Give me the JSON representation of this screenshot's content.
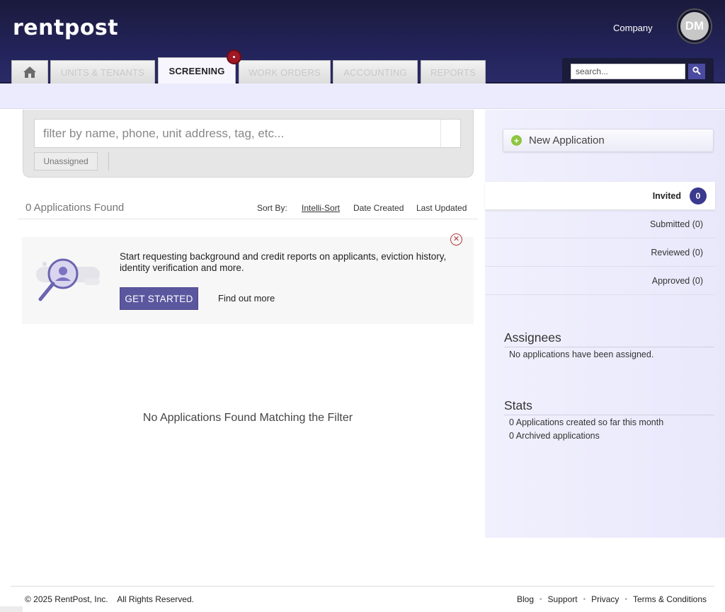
{
  "header": {
    "logo": "rentpost",
    "company_label": "Company",
    "avatar_initials": "DM",
    "tabs": [
      {
        "label": ""
      },
      {
        "label": "UNITS & TENANTS"
      },
      {
        "label": "SCREENING"
      },
      {
        "label": "WORK ORDERS"
      },
      {
        "label": "ACCOUNTING"
      },
      {
        "label": "REPORTS"
      }
    ],
    "search_placeholder": "search..."
  },
  "filter": {
    "placeholder": "filter by name, phone, unit address, tag, etc...",
    "unassigned_label": "Unassigned"
  },
  "results": {
    "count_text": "0 Applications Found",
    "sort_by_label": "Sort By:",
    "sort_options": [
      "Intelli-Sort",
      "Date Created",
      "Last Updated"
    ],
    "empty_text": "No Applications Found Matching the Filter"
  },
  "promo": {
    "text": "Start requesting background and credit reports on applicants, eviction history, identity verification and more.",
    "cta_label": "GET STARTED",
    "link_label": "Find out more"
  },
  "sidebar": {
    "new_application_label": "New Application",
    "statuses": [
      {
        "label": "Invited",
        "count": "0"
      },
      {
        "label": "Submitted (0)"
      },
      {
        "label": "Reviewed (0)"
      },
      {
        "label": "Approved (0)"
      }
    ],
    "assignees_heading": "Assignees",
    "assignees_text": "No applications have been assigned.",
    "stats_heading": "Stats",
    "stats": [
      "0 Applications created so far this month",
      "0 Archived applications"
    ]
  },
  "footer": {
    "copyright": "© 2025 RentPost, Inc.    All Rights Reserved.",
    "links": [
      "Blog",
      "Support",
      "Privacy",
      "Terms & Conditions"
    ]
  },
  "colors": {
    "header_bg": "#23235a",
    "accent": "#5b579f",
    "count_badge": "#3b3a8e",
    "notification": "#a01725",
    "add_green": "#8dc63f"
  }
}
